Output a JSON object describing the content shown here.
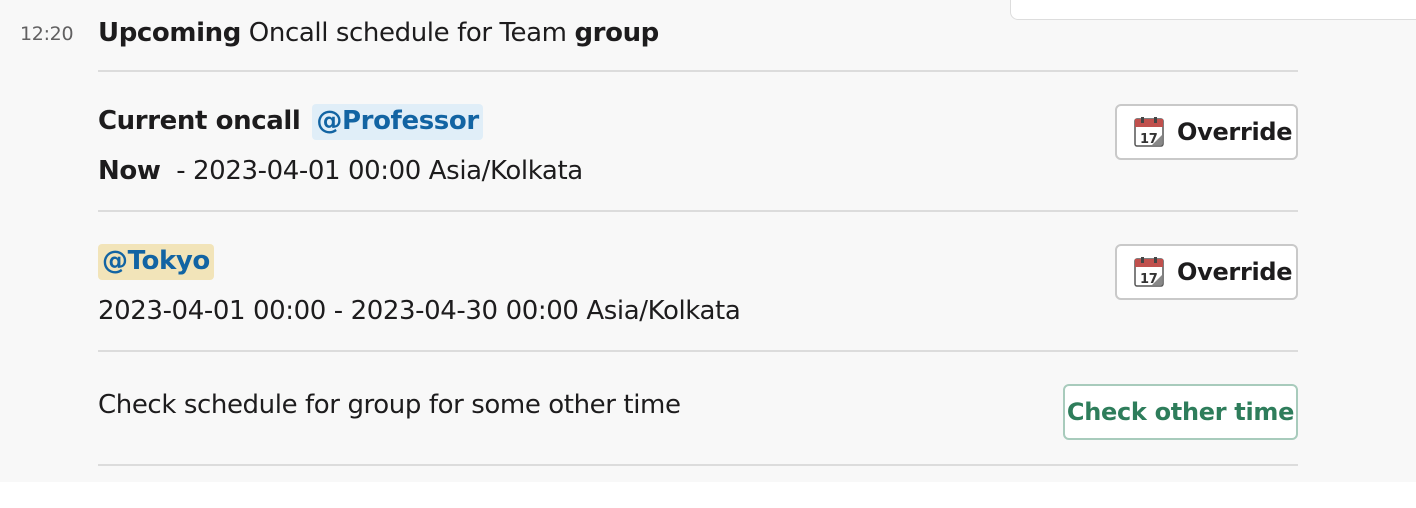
{
  "message": {
    "timestamp": "12:20",
    "header": {
      "prefix": "Upcoming",
      "middle": " Oncall schedule for Team ",
      "team": "group"
    }
  },
  "current_oncall": {
    "label": "Current oncall",
    "user": "@Professor",
    "start": "Now",
    "range_rest": " - 2023-04-01 00:00 Asia/Kolkata",
    "override_label": "Override"
  },
  "next_oncall": {
    "user": "@Tokyo",
    "range": "2023-04-01 00:00 - 2023-04-30 00:00 Asia/Kolkata",
    "override_label": "Override"
  },
  "other_time": {
    "text": "Check schedule for group for some other time",
    "button_label": "Check other time"
  },
  "icons": {
    "calendar": "calendar-icon",
    "calendar_day": "17"
  },
  "colors": {
    "mention_text": "#1264a3",
    "mention_bg_current": "#e0eef8",
    "mention_bg_next": "#f2e4b9",
    "primary_button_text": "#2e7d5b"
  }
}
